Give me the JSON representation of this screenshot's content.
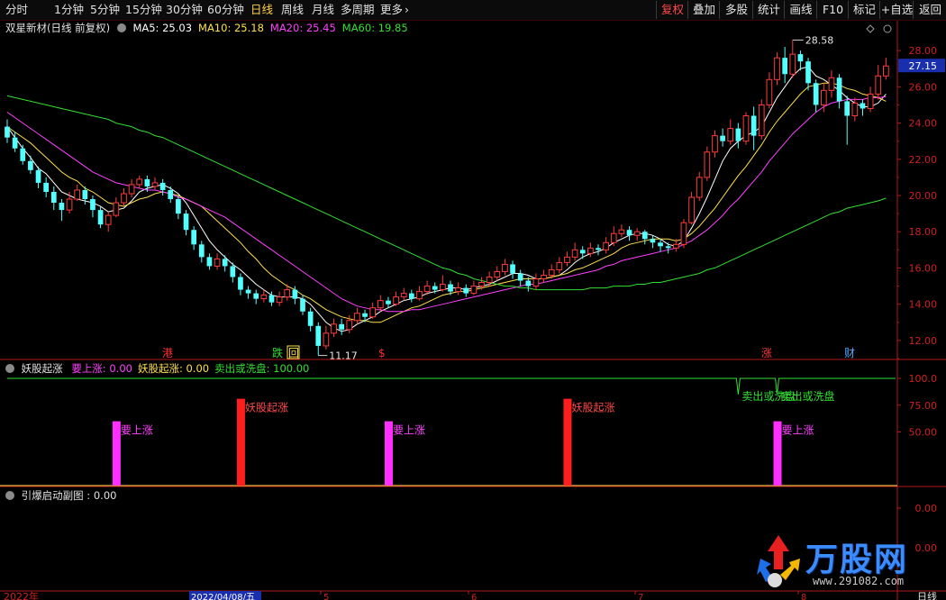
{
  "toolbar": {
    "periods": [
      "分时",
      "1分钟",
      "5分钟",
      "15分钟",
      "30分钟",
      "60分钟",
      "日线",
      "周线",
      "月线",
      "多周期",
      "更多"
    ],
    "active_period": "日线",
    "right": [
      "复权",
      "叠加",
      "多股",
      "统计",
      "画线",
      "F10",
      "标记",
      "+自选",
      "返回"
    ],
    "active_right": "复权"
  },
  "header": {
    "stock": "双星新材(日线 前复权)",
    "ma": [
      {
        "label": "MA5: 25.03",
        "color": "#ffffff"
      },
      {
        "label": "MA10: 25.18",
        "color": "#ffe04a"
      },
      {
        "label": "MA20: 25.45",
        "color": "#ff40ff"
      },
      {
        "label": "MA60: 19.85",
        "color": "#30e030"
      }
    ]
  },
  "price_axis": {
    "ticks": [
      "28.00",
      "26.00",
      "24.00",
      "22.00",
      "20.00",
      "18.00",
      "16.00",
      "14.00",
      "12.00"
    ],
    "current": "27.15",
    "high_label": "28.58",
    "low_label": "11.17"
  },
  "markers": [
    {
      "text": "港",
      "color": "#ff3030"
    },
    {
      "text": "跌",
      "color": "#30e030"
    },
    {
      "text": "回",
      "color": "#ffe04a"
    },
    {
      "text": "$",
      "color": "#ff3030"
    },
    {
      "text": "涨",
      "color": "#ff3030"
    },
    {
      "text": "财",
      "color": "#50a8ff"
    }
  ],
  "indicator1": {
    "name": "妖股起涨",
    "values": [
      {
        "label": "要上涨: 0.00",
        "color": "#ff40ff"
      },
      {
        "label": "妖股起涨: 0.00",
        "color": "#ffe04a"
      },
      {
        "label": "卖出或洗盘: 100.00",
        "color": "#30e030"
      }
    ],
    "axis": [
      "100.0",
      "75.00",
      "50.00"
    ],
    "signals": {
      "up": "要上涨",
      "yao": "妖股起涨",
      "sell": "卖出或洗盘"
    }
  },
  "indicator2": {
    "name": "引爆启动副图 : 0.00",
    "axis": [
      "0.00",
      "0.00"
    ]
  },
  "bottom": {
    "year_label": "2022年",
    "date_label": "2022/04/08/五",
    "axis_ticks": [
      "5",
      "6",
      "7",
      "8"
    ],
    "right_label": "日线"
  },
  "watermark": {
    "text": "万股网",
    "url": "www.291082.com"
  },
  "chart_data": {
    "type": "candlestick",
    "y_range": [
      11,
      29
    ],
    "candles": [
      [
        23.8,
        23.2,
        24.2,
        22.9
      ],
      [
        23.2,
        22.6,
        23.5,
        22.4
      ],
      [
        22.6,
        21.9,
        22.8,
        21.7
      ],
      [
        21.9,
        21.4,
        22.2,
        21.2
      ],
      [
        21.4,
        20.7,
        21.6,
        20.4
      ],
      [
        20.7,
        20.2,
        21.0,
        19.9
      ],
      [
        20.2,
        19.6,
        20.5,
        19.2
      ],
      [
        19.6,
        19.2,
        19.8,
        18.6
      ],
      [
        19.2,
        19.8,
        20.2,
        19.0
      ],
      [
        19.8,
        20.3,
        20.6,
        19.7
      ],
      [
        20.3,
        19.8,
        20.5,
        19.5
      ],
      [
        19.8,
        19.2,
        20.0,
        18.8
      ],
      [
        19.2,
        18.4,
        19.4,
        18.2
      ],
      [
        18.4,
        18.9,
        19.1,
        18.0
      ],
      [
        18.9,
        19.6,
        19.9,
        18.8
      ],
      [
        19.6,
        20.1,
        20.4,
        19.4
      ],
      [
        20.1,
        20.6,
        20.9,
        19.9
      ],
      [
        20.6,
        20.9,
        21.1,
        20.4
      ],
      [
        20.9,
        20.5,
        21.1,
        20.2
      ],
      [
        20.5,
        20.7,
        21.0,
        20.3
      ],
      [
        20.7,
        20.3,
        20.9,
        20.0
      ],
      [
        20.3,
        19.8,
        20.5,
        19.6
      ],
      [
        19.8,
        19.0,
        20.0,
        18.7
      ],
      [
        19.0,
        18.1,
        19.2,
        17.8
      ],
      [
        18.1,
        17.3,
        18.3,
        17.0
      ],
      [
        17.3,
        16.6,
        17.5,
        16.3
      ],
      [
        16.6,
        16.1,
        16.8,
        15.9
      ],
      [
        16.1,
        16.5,
        16.8,
        15.9
      ],
      [
        16.5,
        16.1,
        16.7,
        15.8
      ],
      [
        16.1,
        15.5,
        16.3,
        15.2
      ],
      [
        15.5,
        14.8,
        15.7,
        14.5
      ],
      [
        14.8,
        14.6,
        15.0,
        14.3
      ],
      [
        14.6,
        14.3,
        14.8,
        14.0
      ],
      [
        14.3,
        14.5,
        14.8,
        14.1
      ],
      [
        14.5,
        14.1,
        14.7,
        13.9
      ],
      [
        14.1,
        14.4,
        14.7,
        13.9
      ],
      [
        14.4,
        14.8,
        15.1,
        14.2
      ],
      [
        14.8,
        14.3,
        15.0,
        14.0
      ],
      [
        14.3,
        13.6,
        14.5,
        13.4
      ],
      [
        13.6,
        12.8,
        13.8,
        12.5
      ],
      [
        12.8,
        11.7,
        13.0,
        11.17
      ],
      [
        11.7,
        12.4,
        12.8,
        11.5
      ],
      [
        12.4,
        12.9,
        13.2,
        12.2
      ],
      [
        12.9,
        12.6,
        13.2,
        12.3
      ],
      [
        12.6,
        13.1,
        13.4,
        12.4
      ],
      [
        13.1,
        13.5,
        13.8,
        12.9
      ],
      [
        13.5,
        13.3,
        13.7,
        13.0
      ],
      [
        13.3,
        13.8,
        14.1,
        13.2
      ],
      [
        13.8,
        14.2,
        14.5,
        13.6
      ],
      [
        14.2,
        14.0,
        14.4,
        13.8
      ],
      [
        14.0,
        14.4,
        14.7,
        13.9
      ],
      [
        14.4,
        14.6,
        14.9,
        14.2
      ],
      [
        14.6,
        14.3,
        14.8,
        14.1
      ],
      [
        14.3,
        14.7,
        15.0,
        14.2
      ],
      [
        14.7,
        15.0,
        15.3,
        14.5
      ],
      [
        15.0,
        14.8,
        15.2,
        14.6
      ],
      [
        14.8,
        15.1,
        15.6,
        14.7
      ],
      [
        15.1,
        14.7,
        15.3,
        14.5
      ],
      [
        14.7,
        14.9,
        15.2,
        14.5
      ],
      [
        14.9,
        14.6,
        15.1,
        14.4
      ],
      [
        14.6,
        15.0,
        15.3,
        14.5
      ],
      [
        15.0,
        15.2,
        15.5,
        14.8
      ],
      [
        15.2,
        15.5,
        15.8,
        15.0
      ],
      [
        15.5,
        15.8,
        16.1,
        15.3
      ],
      [
        15.8,
        16.2,
        16.5,
        15.6
      ],
      [
        16.2,
        15.7,
        16.4,
        15.4
      ],
      [
        15.7,
        15.3,
        15.9,
        15.0
      ],
      [
        15.3,
        15.0,
        15.5,
        14.7
      ],
      [
        15.0,
        15.4,
        15.7,
        14.8
      ],
      [
        15.4,
        15.6,
        15.9,
        15.2
      ],
      [
        15.6,
        15.9,
        16.2,
        15.4
      ],
      [
        15.9,
        16.3,
        16.6,
        15.7
      ],
      [
        16.3,
        16.6,
        16.9,
        16.1
      ],
      [
        16.6,
        17.0,
        17.4,
        16.4
      ],
      [
        17.0,
        16.8,
        17.2,
        16.5
      ],
      [
        16.8,
        17.1,
        17.4,
        16.6
      ],
      [
        17.1,
        17.0,
        17.3,
        16.7
      ],
      [
        17.0,
        17.4,
        17.7,
        16.8
      ],
      [
        17.4,
        17.9,
        18.3,
        17.2
      ],
      [
        17.9,
        18.1,
        18.4,
        17.7
      ],
      [
        18.1,
        17.8,
        18.3,
        17.5
      ],
      [
        17.8,
        18.0,
        18.2,
        17.5
      ],
      [
        18.0,
        17.6,
        18.1,
        17.3
      ],
      [
        17.6,
        17.4,
        17.8,
        17.1
      ],
      [
        17.4,
        17.2,
        17.6,
        16.9
      ],
      [
        17.2,
        17.1,
        17.4,
        16.8
      ],
      [
        17.1,
        17.3,
        17.6,
        16.9
      ],
      [
        17.3,
        18.5,
        18.7,
        17.1
      ],
      [
        18.5,
        19.9,
        20.2,
        18.4
      ],
      [
        19.9,
        21.0,
        21.3,
        19.7
      ],
      [
        21.0,
        22.4,
        22.7,
        20.8
      ],
      [
        22.4,
        23.3,
        23.6,
        22.1
      ],
      [
        23.3,
        23.0,
        23.7,
        22.7
      ],
      [
        23.0,
        23.7,
        24.2,
        22.8
      ],
      [
        23.7,
        23.0,
        24.0,
        22.6
      ],
      [
        23.0,
        24.4,
        24.6,
        22.8
      ],
      [
        24.4,
        23.3,
        24.9,
        22.5
      ],
      [
        23.3,
        25.0,
        25.3,
        23.1
      ],
      [
        25.0,
        26.4,
        26.8,
        24.8
      ],
      [
        26.4,
        27.6,
        27.9,
        26.1
      ],
      [
        27.6,
        26.7,
        28.2,
        26.2
      ],
      [
        26.7,
        27.8,
        28.58,
        26.5
      ],
      [
        27.8,
        27.4,
        28.0,
        26.9
      ],
      [
        27.4,
        26.2,
        27.6,
        25.8
      ],
      [
        26.2,
        25.0,
        26.4,
        24.6
      ],
      [
        25.0,
        25.8,
        26.2,
        24.6
      ],
      [
        25.8,
        26.5,
        26.9,
        25.4
      ],
      [
        26.5,
        25.2,
        26.7,
        24.8
      ],
      [
        25.2,
        24.4,
        25.5,
        22.8
      ],
      [
        24.4,
        25.1,
        25.4,
        24.1
      ],
      [
        25.1,
        24.8,
        25.3,
        24.4
      ],
      [
        24.8,
        25.6,
        26.0,
        24.6
      ],
      [
        25.6,
        26.6,
        27.2,
        25.3
      ],
      [
        26.6,
        27.15,
        27.6,
        26.4
      ]
    ],
    "ma_series": [
      {
        "name": "MA5",
        "color": "#ffffff",
        "values": [
          23.8,
          23.2,
          22.6,
          22.1,
          21.5,
          21.2,
          20.7,
          20.2,
          20.0,
          19.8,
          19.7,
          19.6,
          19.4,
          19.1,
          19.2,
          19.3,
          19.7,
          20.2,
          20.4,
          20.5,
          20.6,
          20.4,
          20.1,
          19.6,
          18.9,
          18.2,
          17.5,
          17.0,
          16.6,
          16.2,
          15.9,
          15.5,
          15.1,
          14.8,
          14.5,
          14.4,
          14.4,
          14.4,
          14.3,
          14.0,
          13.5,
          13.0,
          12.7,
          12.5,
          12.6,
          12.9,
          13.1,
          13.3,
          13.6,
          13.8,
          14.0,
          14.2,
          14.3,
          14.4,
          14.6,
          14.7,
          14.8,
          14.9,
          14.9,
          14.8,
          14.9,
          15.0,
          15.1,
          15.3,
          15.5,
          15.7,
          15.7,
          15.6,
          15.4,
          15.4,
          15.5,
          15.6,
          15.9,
          16.3,
          16.6,
          16.8,
          16.9,
          17.1,
          17.4,
          17.6,
          17.8,
          17.9,
          17.9,
          17.8,
          17.6,
          17.3,
          17.2,
          17.5,
          18.2,
          19.0,
          19.9,
          20.9,
          21.9,
          22.6,
          23.0,
          23.3,
          23.5,
          23.8,
          24.6,
          25.4,
          26.0,
          26.6,
          27.0,
          27.1,
          26.6,
          26.4,
          26.1,
          25.8,
          25.4,
          25.1,
          24.9,
          24.9,
          25.1,
          25.6
        ]
      },
      {
        "name": "MA10",
        "color": "#ffe04a",
        "values": [
          23.8,
          23.5,
          23.2,
          22.9,
          22.5,
          22.1,
          21.7,
          21.3,
          21.0,
          20.8,
          20.4,
          20.2,
          19.9,
          19.6,
          19.5,
          19.4,
          19.6,
          19.8,
          19.9,
          20.1,
          20.2,
          20.1,
          20.0,
          19.8,
          19.6,
          19.4,
          19.0,
          18.6,
          18.2,
          17.8,
          17.4,
          16.9,
          16.5,
          16.0,
          15.6,
          15.3,
          15.0,
          14.8,
          14.5,
          14.3,
          14.0,
          13.7,
          13.5,
          13.3,
          13.2,
          13.1,
          13.1,
          13.0,
          13.0,
          13.2,
          13.4,
          13.6,
          13.8,
          13.9,
          14.1,
          14.3,
          14.5,
          14.6,
          14.7,
          14.7,
          14.8,
          14.9,
          15.0,
          15.1,
          15.2,
          15.3,
          15.4,
          15.4,
          15.4,
          15.4,
          15.5,
          15.6,
          15.7,
          15.9,
          16.0,
          16.2,
          16.4,
          16.6,
          16.8,
          17.1,
          17.3,
          17.4,
          17.5,
          17.6,
          17.6,
          17.6,
          17.5,
          17.6,
          17.9,
          18.3,
          18.8,
          19.3,
          19.9,
          20.5,
          21.1,
          21.6,
          22.2,
          22.8,
          23.5,
          24.1,
          24.6,
          25.1,
          25.6,
          26.0,
          26.1,
          26.2,
          26.2,
          26.1,
          25.9,
          25.8,
          25.6,
          25.5,
          25.4,
          25.2
        ]
      },
      {
        "name": "MA20",
        "color": "#ff40ff",
        "values": [
          24.6,
          24.3,
          24.0,
          23.7,
          23.4,
          23.1,
          22.8,
          22.5,
          22.2,
          21.9,
          21.6,
          21.3,
          21.1,
          20.9,
          20.7,
          20.6,
          20.5,
          20.4,
          20.3,
          20.3,
          20.2,
          20.1,
          19.9,
          19.8,
          19.6,
          19.4,
          19.2,
          19.0,
          18.8,
          18.5,
          18.2,
          17.9,
          17.6,
          17.3,
          17.0,
          16.7,
          16.4,
          16.1,
          15.8,
          15.5,
          15.2,
          14.9,
          14.6,
          14.3,
          14.1,
          13.9,
          13.8,
          13.7,
          13.7,
          13.6,
          13.6,
          13.6,
          13.7,
          13.7,
          13.8,
          13.9,
          14.0,
          14.1,
          14.2,
          14.3,
          14.4,
          14.5,
          14.6,
          14.7,
          14.8,
          14.9,
          15.0,
          15.1,
          15.1,
          15.2,
          15.3,
          15.4,
          15.5,
          15.6,
          15.7,
          15.8,
          15.9,
          16.1,
          16.2,
          16.4,
          16.5,
          16.6,
          16.7,
          16.8,
          16.9,
          17.0,
          17.1,
          17.3,
          17.5,
          17.8,
          18.1,
          18.5,
          18.9,
          19.4,
          19.8,
          20.3,
          20.8,
          21.3,
          21.9,
          22.4,
          22.9,
          23.4,
          23.8,
          24.2,
          24.6,
          24.9,
          25.1,
          25.2,
          25.3,
          25.3,
          25.3,
          25.4,
          25.4,
          25.45
        ]
      },
      {
        "name": "MA60",
        "color": "#30e030",
        "values": [
          25.5,
          25.4,
          25.3,
          25.2,
          25.1,
          25.0,
          24.9,
          24.8,
          24.7,
          24.6,
          24.5,
          24.4,
          24.3,
          24.2,
          24.0,
          23.9,
          23.8,
          23.6,
          23.5,
          23.3,
          23.2,
          23.0,
          22.8,
          22.6,
          22.4,
          22.2,
          22.0,
          21.8,
          21.6,
          21.4,
          21.2,
          21.0,
          20.8,
          20.6,
          20.4,
          20.2,
          20.0,
          19.8,
          19.6,
          19.4,
          19.2,
          19.0,
          18.8,
          18.6,
          18.4,
          18.2,
          18.0,
          17.8,
          17.6,
          17.4,
          17.2,
          17.0,
          16.8,
          16.6,
          16.4,
          16.2,
          16.0,
          15.9,
          15.7,
          15.6,
          15.4,
          15.3,
          15.2,
          15.1,
          15.0,
          15.0,
          14.9,
          14.9,
          14.8,
          14.8,
          14.8,
          14.8,
          14.8,
          14.8,
          14.8,
          14.9,
          14.9,
          14.9,
          15.0,
          15.0,
          15.0,
          15.1,
          15.1,
          15.2,
          15.2,
          15.3,
          15.4,
          15.5,
          15.6,
          15.7,
          15.9,
          16.0,
          16.2,
          16.4,
          16.6,
          16.8,
          17.0,
          17.2,
          17.4,
          17.6,
          17.8,
          18.0,
          18.2,
          18.4,
          18.6,
          18.8,
          19.0,
          19.1,
          19.3,
          19.4,
          19.5,
          19.6,
          19.7,
          19.85
        ]
      }
    ],
    "signal_up_index": [
      14,
      49,
      99
    ],
    "signal_yao_index": [
      30,
      72
    ],
    "sell_dip_index": [
      94,
      99
    ]
  }
}
